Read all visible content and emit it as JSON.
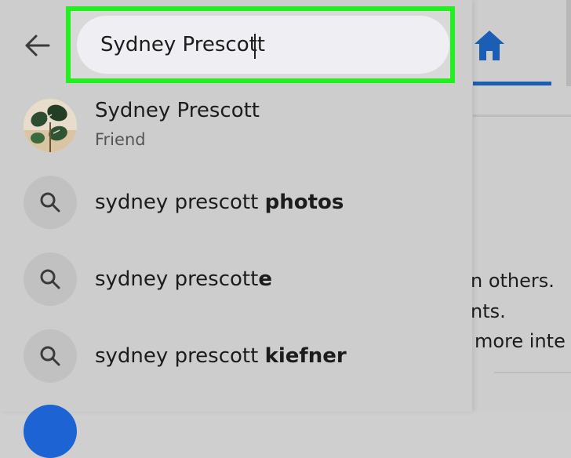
{
  "search": {
    "value": "Sydney Prescott"
  },
  "results": [
    {
      "type": "person",
      "title": "Sydney Prescott",
      "subtitle": "Friend"
    },
    {
      "type": "query",
      "prefix": "sydney prescott ",
      "bold": "photos"
    },
    {
      "type": "query",
      "prefix": "sydney prescott",
      "bold": "e"
    },
    {
      "type": "query",
      "prefix": "sydney prescott ",
      "bold": "kiefner"
    }
  ],
  "background": {
    "lines": [
      "n others.",
      "nts.",
      " more inte"
    ]
  },
  "colors": {
    "highlight": "#22ee22",
    "brand": "#1a5fb4"
  },
  "icons": {
    "back": "arrow-left-icon",
    "home": "home-icon",
    "search": "search-icon"
  }
}
